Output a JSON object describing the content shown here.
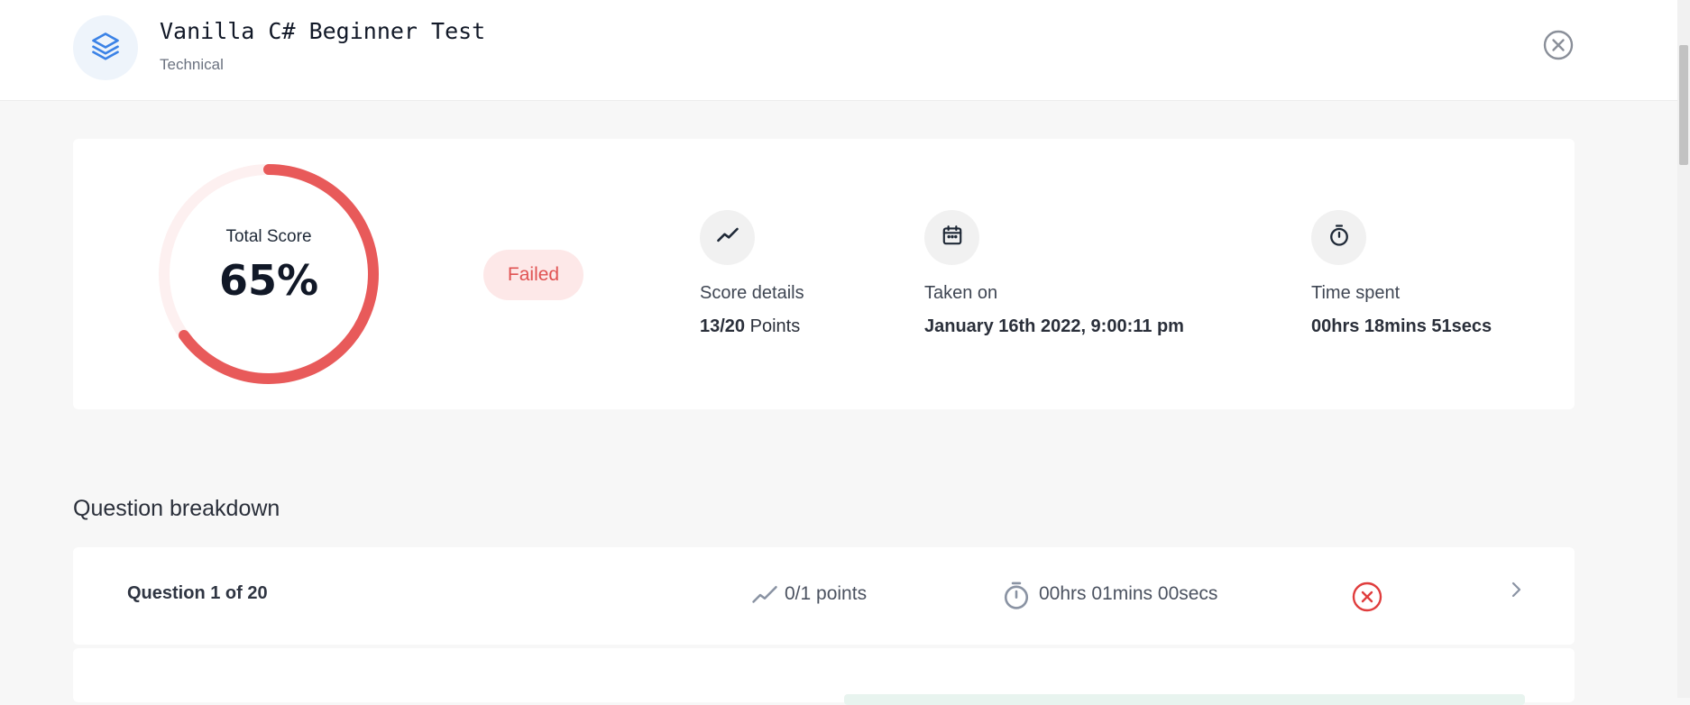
{
  "header": {
    "title": "Vanilla C# Beginner Test",
    "subtitle": "Technical",
    "logo_icon": "stack-layers-icon",
    "close_icon": "close-circle-icon"
  },
  "score": {
    "label": "Total Score",
    "value": "65%",
    "percent": 65,
    "status": "Failed",
    "colors": {
      "ring": "#e85a5a",
      "ring_track": "#fdf0f0",
      "status_bg": "#fde8e8",
      "status_text": "#e05252"
    }
  },
  "stats": [
    {
      "icon": "trend-line-icon",
      "label": "Score details",
      "value_bold": "13/20",
      "value_rest": " Points"
    },
    {
      "icon": "calendar-icon",
      "label": "Taken on",
      "value_bold": "January 16th 2022, 9:00:11 pm",
      "value_rest": ""
    },
    {
      "icon": "stopwatch-icon",
      "label": "Time spent",
      "value_bold": "00hrs 18mins 51secs",
      "value_rest": ""
    }
  ],
  "breakdown": {
    "title": "Question breakdown",
    "questions": [
      {
        "title": "Question 1 of 20",
        "points": "0/1 points",
        "time": "00hrs 01mins 00secs",
        "result": "incorrect"
      }
    ]
  }
}
